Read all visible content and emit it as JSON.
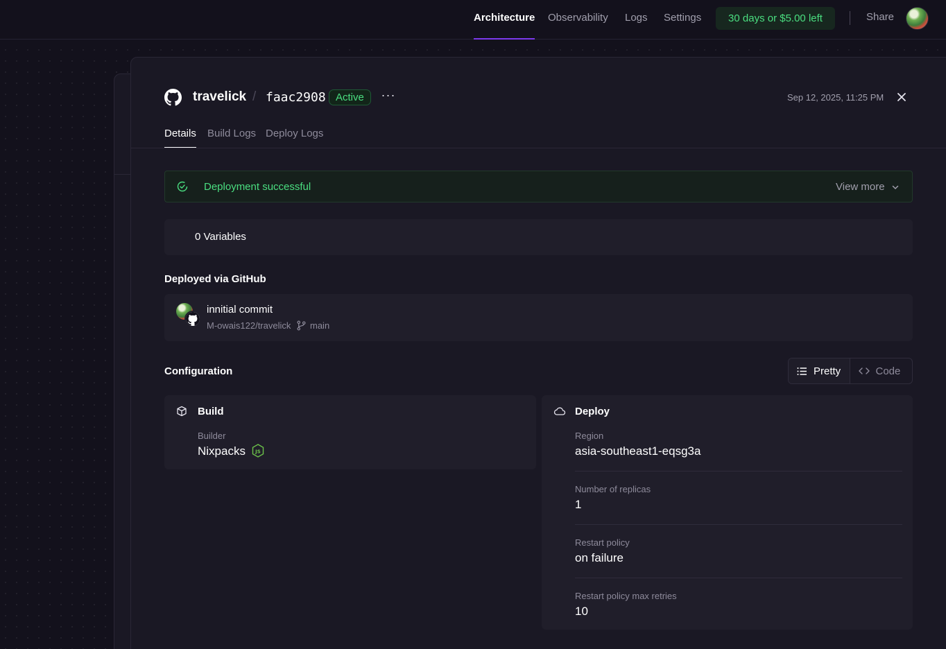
{
  "topnav": {
    "tabs": [
      "Architecture",
      "Observability",
      "Logs",
      "Settings"
    ],
    "active_tab": "Architecture",
    "trial": "30 days or $5.00 left",
    "share": "Share"
  },
  "deployment": {
    "project": "travelick",
    "separator": "/",
    "commit_hash": "faac2908",
    "status": "Active",
    "more": "···",
    "timestamp": "Sep 12, 2025, 11:25 PM",
    "tabs": [
      "Details",
      "Build Logs",
      "Deploy Logs"
    ],
    "active_tab": "Details"
  },
  "banner": {
    "message": "Deployment successful",
    "view_more": "View more"
  },
  "variables": {
    "label": "0 Variables"
  },
  "source": {
    "heading": "Deployed via GitHub",
    "commit_message": "innitial commit",
    "repo": "M-owais122/travelick",
    "branch": "main"
  },
  "configuration": {
    "heading": "Configuration",
    "view_modes": [
      "Pretty",
      "Code"
    ],
    "active_view": "Pretty",
    "build": {
      "title": "Build",
      "builder_label": "Builder",
      "builder_value": "Nixpacks",
      "builder_icon": "nodejs-icon"
    },
    "deploy": {
      "title": "Deploy",
      "fields": [
        {
          "label": "Region",
          "value": "asia-southeast1-eqsg3a"
        },
        {
          "label": "Number of replicas",
          "value": "1"
        },
        {
          "label": "Restart policy",
          "value": "on failure"
        },
        {
          "label": "Restart policy max retries",
          "value": "10"
        }
      ]
    }
  },
  "colors": {
    "background": "#13111c",
    "panel": "#1a1824",
    "accent": "#7c3aed",
    "success": "#4ade80"
  }
}
